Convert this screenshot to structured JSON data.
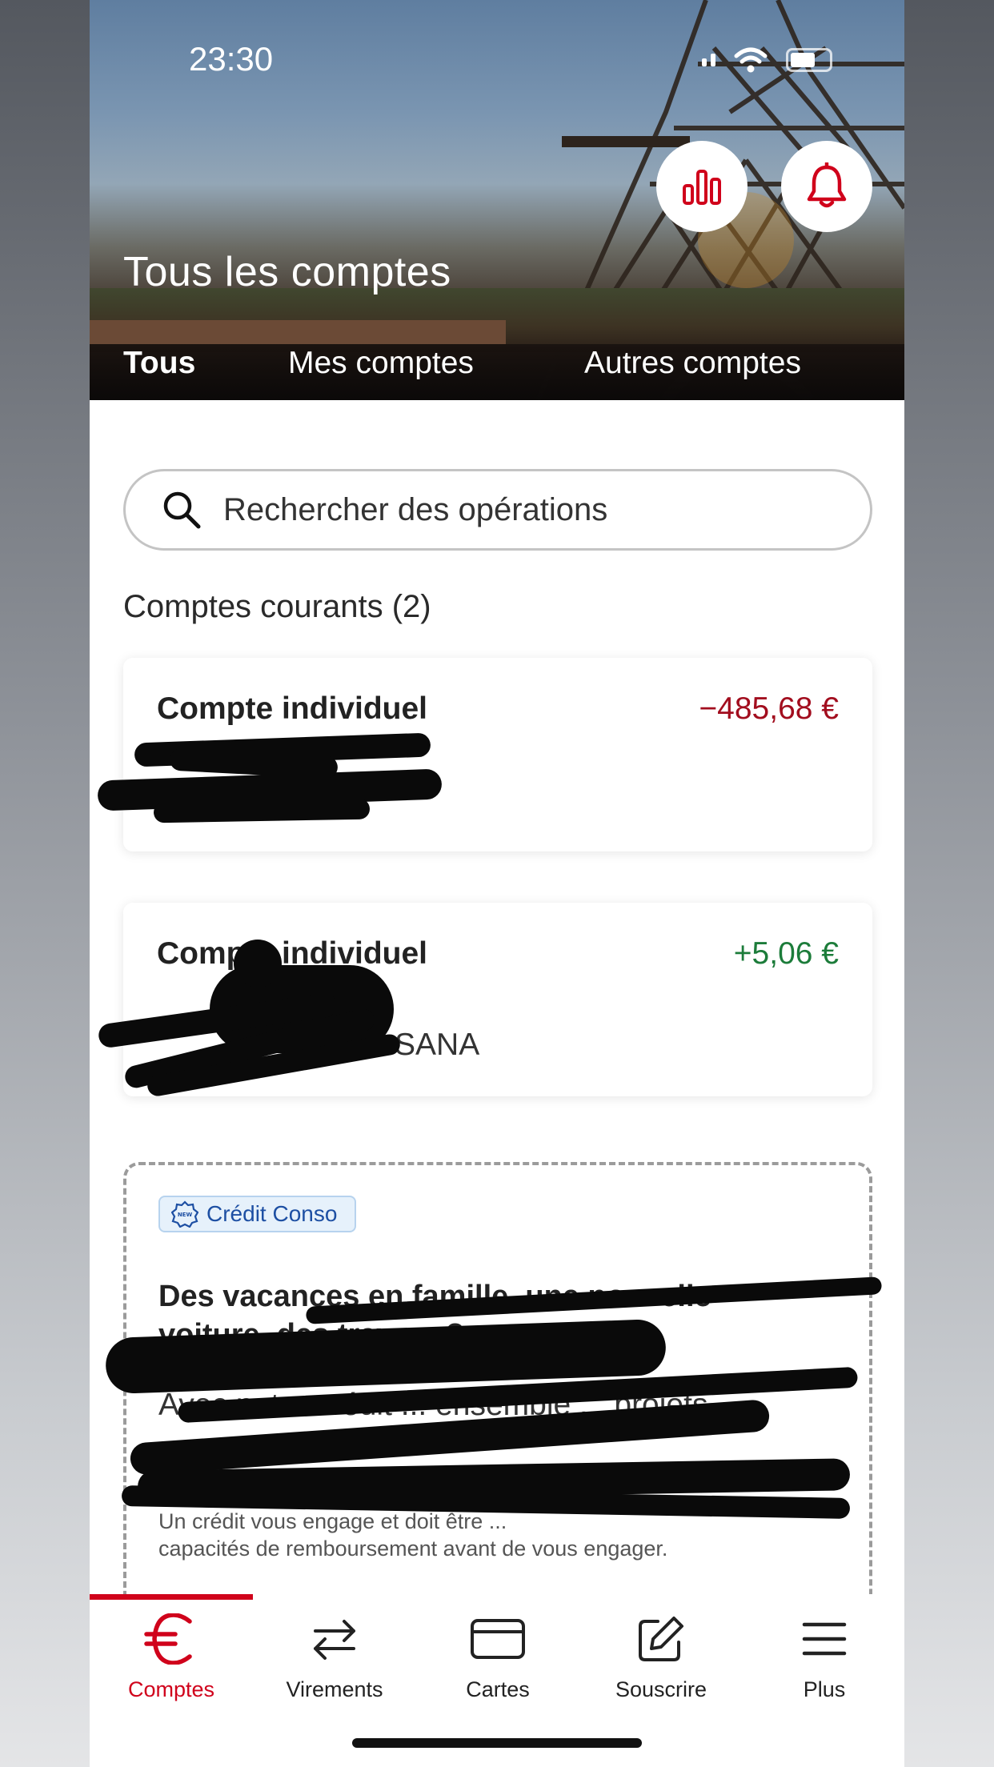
{
  "status_bar": {
    "time": "23:30"
  },
  "header": {
    "title": "Tous les comptes",
    "tabs": [
      {
        "label": "Tous",
        "active": true
      },
      {
        "label": "Mes comptes",
        "active": false
      },
      {
        "label": "Autres comptes",
        "active": false
      }
    ],
    "buttons": [
      {
        "icon": "bar-chart-icon"
      },
      {
        "icon": "bell-icon"
      }
    ]
  },
  "search": {
    "placeholder": "Rechercher des opérations"
  },
  "accounts_section": {
    "title": "Comptes courants (2)",
    "accounts": [
      {
        "name": "Compte individuel",
        "amount": "−485,68 €",
        "status_color": "#a20d1e"
      },
      {
        "name": "Compte individuel",
        "amount": "+5,06 €",
        "holder_partial": "R SANA",
        "status_color": "#1c7c3a"
      }
    ]
  },
  "promo": {
    "badge": "Crédit Conso",
    "badge_icon": "new-badge-icon",
    "title": "Des vacances en famille, une nouvelle voiture, des travaux?",
    "body": "Avec notre crédit ... ensemble ... projets.",
    "legal_line_1": "Un crédit vous engage et doit être ...",
    "legal_line_2": "capacités de remboursement avant de vous engager."
  },
  "bottom_nav": {
    "items": [
      {
        "label": "Comptes",
        "icon": "euro-icon",
        "active": true
      },
      {
        "label": "Virements",
        "icon": "transfer-arrows-icon",
        "active": false
      },
      {
        "label": "Cartes",
        "icon": "card-icon",
        "active": false
      },
      {
        "label": "Souscrire",
        "icon": "edit-icon",
        "active": false
      },
      {
        "label": "Plus",
        "icon": "menu-icon",
        "active": false
      }
    ],
    "accent_color": "#d0021b"
  }
}
